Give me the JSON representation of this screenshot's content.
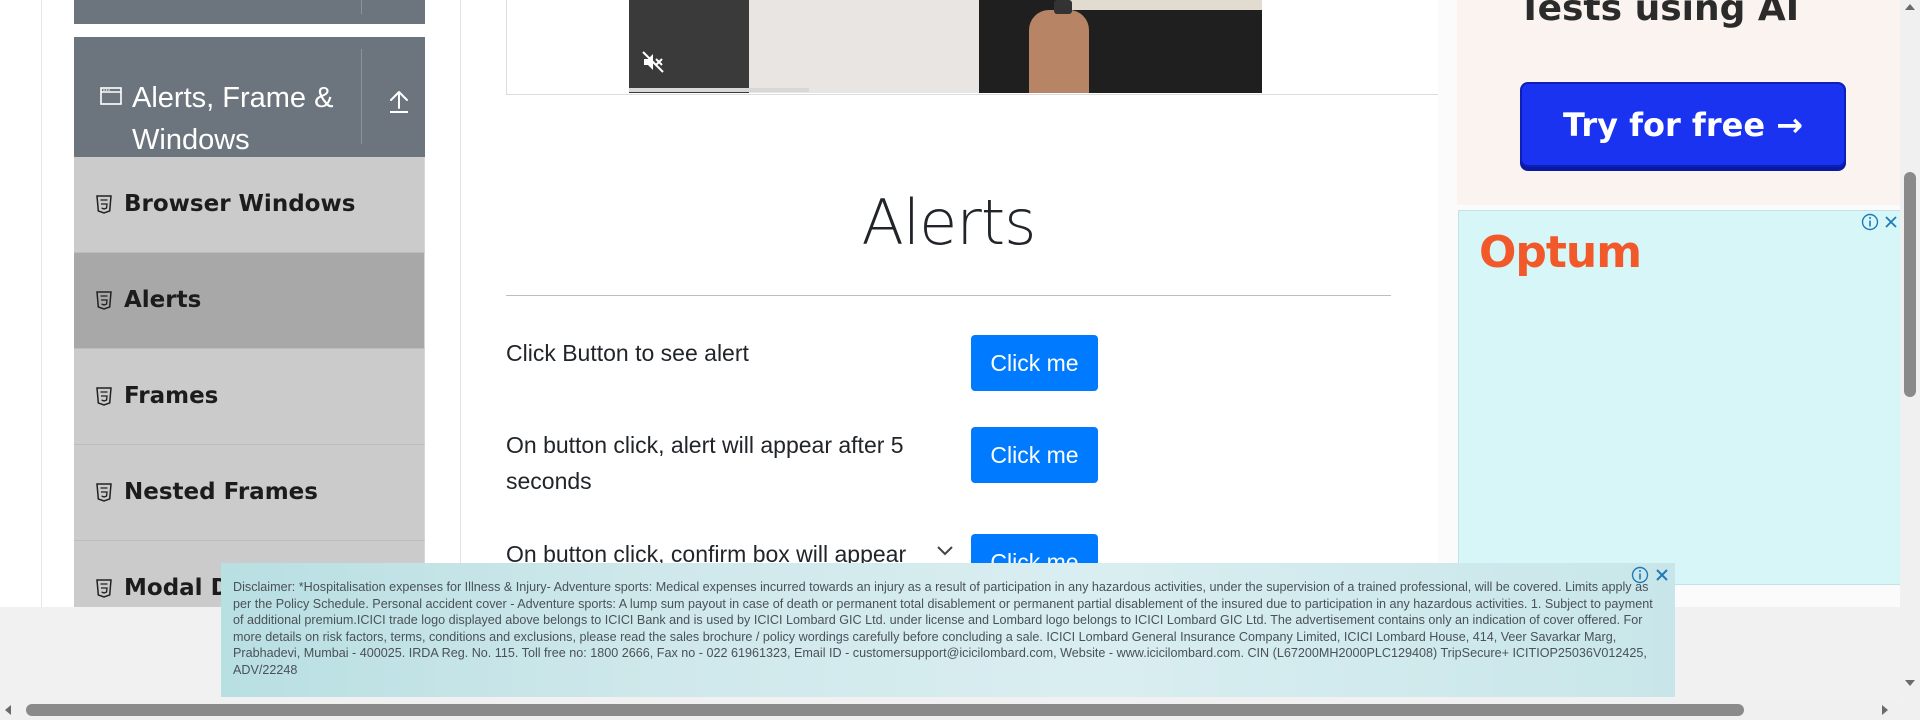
{
  "sidebar": {
    "group_title": "Alerts, Frame & Windows",
    "items": [
      {
        "label": "Browser Windows",
        "active": false
      },
      {
        "label": "Alerts",
        "active": true
      },
      {
        "label": "Frames",
        "active": false
      },
      {
        "label": "Nested Frames",
        "active": false
      },
      {
        "label": "Modal Dialogs",
        "active": false
      }
    ],
    "icons": {
      "group": "window-icon",
      "collapse": "collapse-up-icon",
      "item": "html5-file-icon"
    }
  },
  "video": {
    "icon": "mute-icon"
  },
  "main": {
    "title": "Alerts",
    "rows": [
      {
        "text": "Click Button to see alert",
        "button": "Click me"
      },
      {
        "text": "On button click, alert will appear after 5 seconds",
        "button": "Click me"
      },
      {
        "text": "On button click, confirm box will appear",
        "button": "Click me"
      }
    ],
    "accent_color": "#007bff"
  },
  "ads": {
    "top_heading": "Tests using AI",
    "top_button": "Try for free →",
    "optum_logo": "Optum",
    "bottom_disclaimer": "Disclaimer: *Hospitalisation expenses for Illness & Injury- Adventure sports: Medical expenses incurred towards an injury as a result of participation in any hazardous activities, under the supervision of a trained professional, will be covered. Limits apply as per the Policy Schedule. Personal accident cover - Adventure sports: A lump sum payout in case of death or permanent total disablement or permanent partial disablement of the insured due to participation in any hazardous activities. 1. Subject to payment of additional premium.ICICI trade logo displayed above belongs to ICICI Bank and is used by ICICI Lombard GIC Ltd. under license and Lombard logo belongs to ICICI Lombard GIC Ltd. The advertisement contains only an indication of cover offered. For more details on risk factors, terms, conditions and exclusions, please read the sales brochure / policy wordings carefully before concluding a sale. ICICI Lombard General Insurance Company Limited, ICICI Lombard House, 414, Veer Savarkar Marg, Prabhadevi, Mumbai - 400025. IRDA Reg. No. 115. Toll free no: 1800 2666, Fax no - 022 61961323, Email ID - customersupport@icicilombard.com, Website - www.icicilombard.com. CIN (L67200MH2000PLC129408) TripSecure+ ICITIOP25036V012425, ADV/22248"
  }
}
